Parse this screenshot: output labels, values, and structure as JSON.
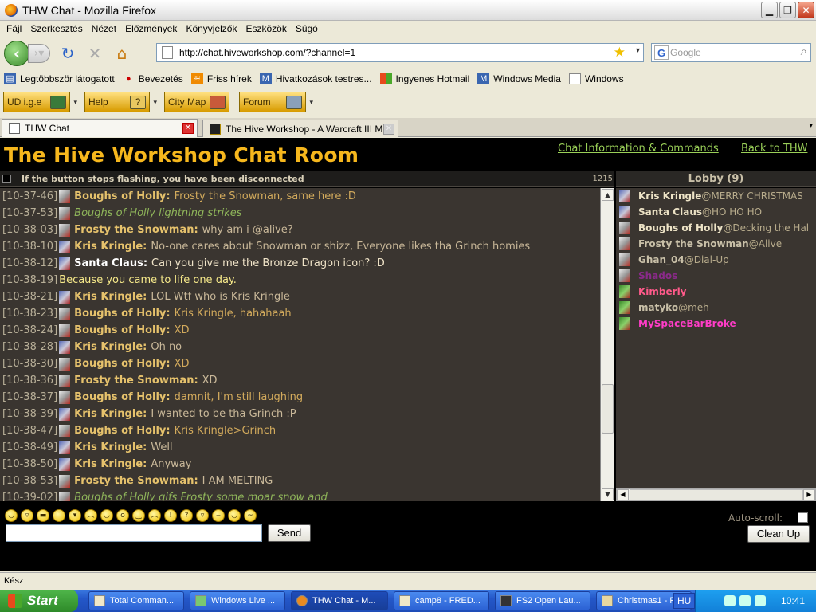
{
  "window": {
    "title": "THW Chat - Mozilla Firefox"
  },
  "menu": [
    "Fájl",
    "Szerkesztés",
    "Nézet",
    "Előzmények",
    "Könyvjelzők",
    "Eszközök",
    "Súgó"
  ],
  "nav": {
    "url": "http://chat.hiveworkshop.com/?channel=1",
    "search_placeholder": "Google"
  },
  "bookmarks": [
    "Legtöbbször látogatott",
    "Bevezetés",
    "Friss hírek",
    "Hivatkozások testres...",
    "Ingyenes Hotmail",
    "Windows Media",
    "Windows"
  ],
  "toolbar": {
    "buttons": [
      "UD i.g.e",
      "Help",
      "City Map",
      "Forum"
    ]
  },
  "tabs": [
    {
      "label": "THW Chat",
      "active": true
    },
    {
      "label": "The Hive Workshop - A Warcraft III M...",
      "active": false
    }
  ],
  "page": {
    "title": "The Hive Workshop Chat Room",
    "link_info": "Chat Information & Commands",
    "link_back": "Back to THW",
    "status_msg": "If the button stops flashing, you have been disconnected",
    "counter": "1215",
    "lobby_title": "Lobby (9)",
    "send_label": "Send",
    "autoscroll_label": "Auto-scroll:",
    "cleanup_label": "Clean Up"
  },
  "messages": [
    {
      "ts": "[10-37-46]",
      "nick": "Boughs of Holly:",
      "text": "Frosty the Snowman, same here :D",
      "kind": "tan",
      "av": "a2"
    },
    {
      "ts": "[10-37-53]",
      "emote": "Boughs of Holly lightning strikes",
      "kind": "emote",
      "av": "a2"
    },
    {
      "ts": "[10-38-03]",
      "nick": "Frosty the Snowman:",
      "text": "why am i @alive?",
      "kind": "plain",
      "av": "a2"
    },
    {
      "ts": "[10-38-10]",
      "nick": "Kris Kringle:",
      "text": "No-one cares about Snowman or shizz, Everyone likes tha Grinch homies",
      "kind": "plain",
      "av": "a1"
    },
    {
      "ts": "[10-38-12]",
      "nick": "Santa Claus:",
      "text": "Can you give me the Bronze Dragon icon? :D",
      "kind": "bright",
      "av": "a1",
      "white": true
    },
    {
      "ts": "[10-38-19]",
      "system": "Because you came to life one day.",
      "kind": "system"
    },
    {
      "ts": "[10-38-21]",
      "nick": "Kris Kringle:",
      "text": "LOL Wtf who is Kris Kringle",
      "kind": "plain",
      "av": "a1"
    },
    {
      "ts": "[10-38-23]",
      "nick": "Boughs of Holly:",
      "text": "Kris Kringle, hahahaah",
      "kind": "tan",
      "av": "a2"
    },
    {
      "ts": "[10-38-24]",
      "nick": "Boughs of Holly:",
      "text": "XD",
      "kind": "tan",
      "av": "a2"
    },
    {
      "ts": "[10-38-28]",
      "nick": "Kris Kringle:",
      "text": "Oh no",
      "kind": "plain",
      "av": "a1"
    },
    {
      "ts": "[10-38-30]",
      "nick": "Boughs of Holly:",
      "text": "XD",
      "kind": "tan",
      "av": "a2"
    },
    {
      "ts": "[10-38-36]",
      "nick": "Frosty the Snowman:",
      "text": "XD",
      "kind": "plain",
      "av": "a2"
    },
    {
      "ts": "[10-38-37]",
      "nick": "Boughs of Holly:",
      "text": "damnit, I'm still laughing",
      "kind": "tan",
      "av": "a2"
    },
    {
      "ts": "[10-38-39]",
      "nick": "Kris Kringle:",
      "text": "I wanted to be tha Grinch :P",
      "kind": "plain",
      "av": "a1"
    },
    {
      "ts": "[10-38-47]",
      "nick": "Boughs of Holly:",
      "text": "Kris Kringle>Grinch",
      "kind": "tan",
      "av": "a2"
    },
    {
      "ts": "[10-38-49]",
      "nick": "Kris Kringle:",
      "text": "Well",
      "kind": "plain",
      "av": "a1"
    },
    {
      "ts": "[10-38-50]",
      "nick": "Kris Kringle:",
      "text": "Anyway",
      "kind": "plain",
      "av": "a1"
    },
    {
      "ts": "[10-38-53]",
      "nick": "Frosty the Snowman:",
      "text": "I AM MELTING",
      "kind": "plain",
      "av": "a2"
    },
    {
      "ts": "[10-39-02]",
      "emote": "Boughs of Holly gifs Frosty some moar snow and",
      "kind": "emote",
      "av": "a2"
    }
  ],
  "lobby": [
    {
      "name": "Kris Kringle",
      "status": "@MERRY CHRISTMAS",
      "cls": "",
      "av": "a1"
    },
    {
      "name": "Santa Claus",
      "status": "@HO HO HO",
      "cls": "",
      "av": "a1"
    },
    {
      "name": "Boughs of Holly",
      "status": "@Decking the Hal",
      "cls": "",
      "av": "a2"
    },
    {
      "name": "Frosty the Snowman",
      "status": "@Alive",
      "cls": "muted",
      "av": "a2"
    },
    {
      "name": "Ghan_04",
      "status": "@Dial-Up",
      "cls": "muted",
      "av": "a2"
    },
    {
      "name": "Shados",
      "status": "",
      "cls": "purple",
      "av": "a2"
    },
    {
      "name": "Kimberly",
      "status": "",
      "cls": "pink",
      "av": "g"
    },
    {
      "name": "matyko",
      "status": "@meh",
      "cls": "muted",
      "av": "g"
    },
    {
      "name": "MySpaceBarBroke",
      "status": "",
      "cls": "magenta",
      "av": "g"
    }
  ],
  "emoticons": [
    "smile",
    "grin",
    "cool",
    "wink",
    "tongue",
    "sad",
    "happy",
    "shocked",
    "smirk",
    "frown",
    "exclaim",
    "question",
    "laugh",
    "annoyed",
    "blush",
    "dizzy"
  ],
  "statusbar": {
    "text": "Kész"
  },
  "taskbar": {
    "start": "Start",
    "items": [
      "Total Comman...",
      "Windows Live ...",
      "THW Chat - M...",
      "camp8 - FRED...",
      "FS2 Open Lau...",
      "Christmas1 - P..."
    ],
    "lang": "HU",
    "clock": "10:41"
  }
}
